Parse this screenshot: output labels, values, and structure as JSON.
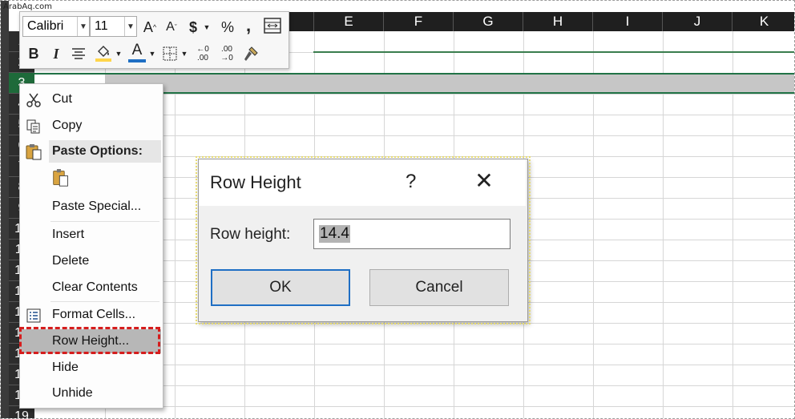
{
  "watermark": "ArabAq.com",
  "columns": [
    "E",
    "F",
    "G",
    "H",
    "I",
    "J",
    "K"
  ],
  "rows": [
    "1",
    "2",
    "3",
    "4",
    "5",
    "6",
    "7",
    "8",
    "9",
    "10",
    "11",
    "12",
    "13",
    "14",
    "15",
    "16",
    "17",
    "18",
    "19"
  ],
  "mini_toolbar": {
    "font_name": "Calibri",
    "font_size": "11",
    "increase_font": "A",
    "decrease_font": "A",
    "currency": "$",
    "percent": "%",
    "comma": ",",
    "bold": "B",
    "italic": "I",
    "font_color": "A",
    "inc_decimal_top": "←0",
    "inc_decimal_bottom": ".00",
    "dec_decimal_top": ".00",
    "dec_decimal_bottom": "→0",
    "font_color_bar": "#e02020",
    "fill_color_bar": "#ffd54a"
  },
  "context_menu": {
    "cut": "Cut",
    "copy": "Copy",
    "paste_options": "Paste Options:",
    "paste_special": "Paste Special...",
    "insert": "Insert",
    "delete": "Delete",
    "clear_contents": "Clear Contents",
    "format_cells": "Format Cells...",
    "row_height": "Row Height...",
    "hide": "Hide",
    "unhide": "Unhide"
  },
  "dialog": {
    "title": "Row Height",
    "help": "?",
    "close": "✕",
    "label": "Row height:",
    "value": "14.4",
    "ok": "OK",
    "cancel": "Cancel"
  },
  "colors": {
    "selection_green": "#217346",
    "highlight_red": "#d51d1d",
    "ok_border": "#1f6fc4"
  }
}
